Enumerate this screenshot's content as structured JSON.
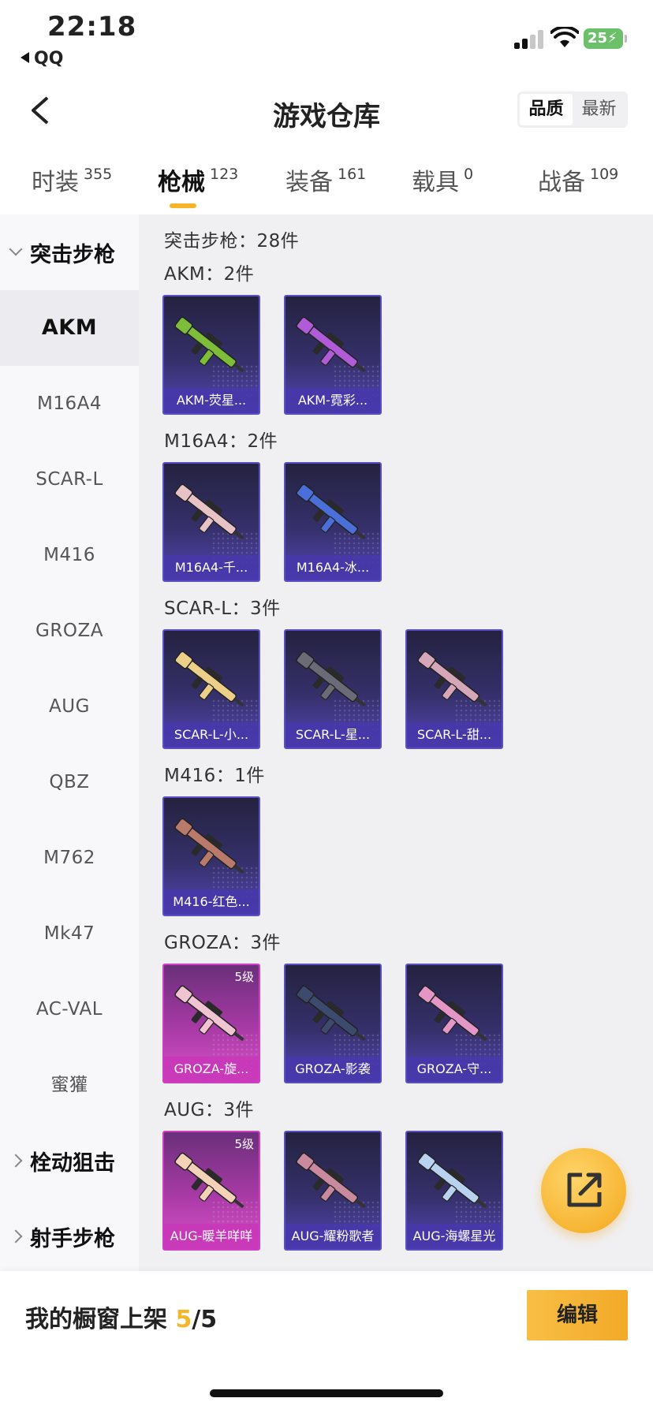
{
  "status_bar": {
    "time": "22:18",
    "back_app": "QQ",
    "battery": "25"
  },
  "header": {
    "title": "游戏仓库",
    "sort_options": [
      "品质",
      "最新"
    ],
    "sort_active": "品质"
  },
  "tabs": [
    {
      "label": "时装",
      "count": "355"
    },
    {
      "label": "枪械",
      "count": "123",
      "active": true
    },
    {
      "label": "装备",
      "count": "161"
    },
    {
      "label": "载具",
      "count": "0"
    },
    {
      "label": "战备",
      "count": "109"
    }
  ],
  "sidebar": {
    "group_assault": "突击步枪",
    "items": [
      "AKM",
      "M16A4",
      "SCAR-L",
      "M416",
      "GROZA",
      "AUG",
      "QBZ",
      "M762",
      "Mk47",
      "AC-VAL",
      "蜜獾"
    ],
    "group_bolt": "栓动狙击",
    "group_marksman": "射手步枪"
  },
  "main": {
    "total_label": "突击步枪：28件",
    "sections": [
      {
        "label": "AKM：2件",
        "items": [
          {
            "name": "AKM-荧星...",
            "rarity": "purple",
            "color": "#7dbd3a"
          },
          {
            "name": "AKM-霓彩...",
            "rarity": "purple",
            "color": "#b05bd8"
          }
        ]
      },
      {
        "label": "M16A4：2件",
        "items": [
          {
            "name": "M16A4-千...",
            "rarity": "purple",
            "color": "#e7c3c8"
          },
          {
            "name": "M16A4-冰...",
            "rarity": "purple",
            "color": "#4a6fd8"
          }
        ]
      },
      {
        "label": "SCAR-L：3件",
        "items": [
          {
            "name": "SCAR-L-小...",
            "rarity": "purple",
            "color": "#ecd08a"
          },
          {
            "name": "SCAR-L-星...",
            "rarity": "purple",
            "color": "#6b6b78"
          },
          {
            "name": "SCAR-L-甜...",
            "rarity": "purple",
            "color": "#d6a7b8"
          }
        ]
      },
      {
        "label": "M416：1件",
        "items": [
          {
            "name": "M416-红色...",
            "rarity": "purple",
            "color": "#b97a6b"
          }
        ]
      },
      {
        "label": "GROZA：3件",
        "items": [
          {
            "name": "GROZA-旋...",
            "rarity": "pink",
            "level": "5级",
            "color": "#f0c4d0"
          },
          {
            "name": "GROZA-影袭",
            "rarity": "purple",
            "color": "#3c4a6e"
          },
          {
            "name": "GROZA-守...",
            "rarity": "purple",
            "color": "#e497c6"
          }
        ]
      },
      {
        "label": "AUG：3件",
        "items": [
          {
            "name": "AUG-暖羊咩咩",
            "rarity": "pink",
            "level": "5级",
            "color": "#f3d2b8"
          },
          {
            "name": "AUG-耀粉歌者",
            "rarity": "purple",
            "color": "#c98aa0"
          },
          {
            "name": "AUG-海螺星光",
            "rarity": "purple",
            "color": "#b9d2f0"
          }
        ]
      }
    ]
  },
  "bottom": {
    "showcase_label": "我的橱窗上架 ",
    "showcase_current": "5",
    "showcase_total": "/5",
    "edit_label": "编辑"
  }
}
